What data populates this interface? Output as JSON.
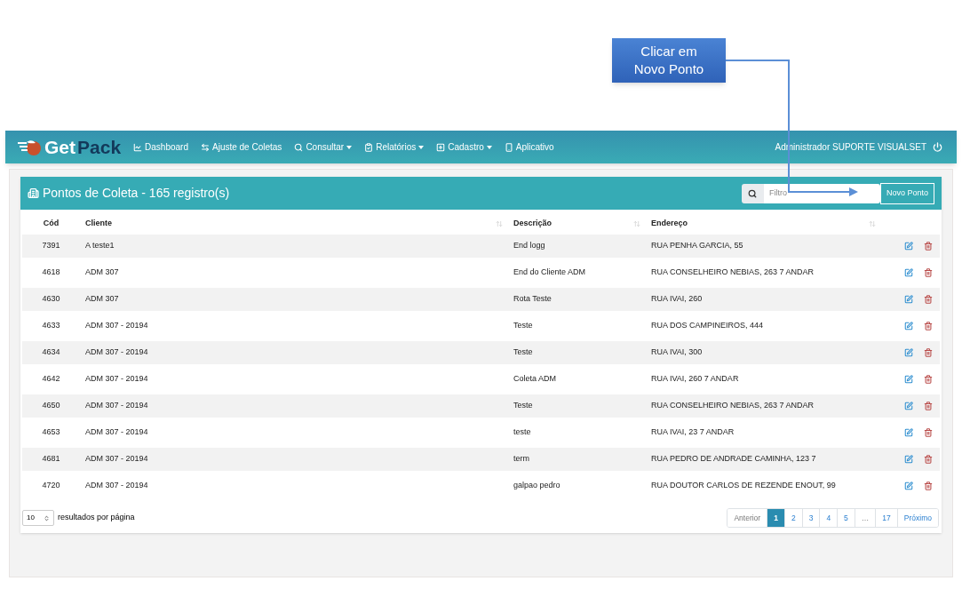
{
  "callout": {
    "lines": [
      "Clicar em",
      "Novo Ponto"
    ]
  },
  "navbar": {
    "logo": {
      "first": "Get",
      "second": "Pack"
    },
    "items": [
      {
        "label": "Dashboard",
        "kind": "chart",
        "dropdown": false
      },
      {
        "label": "Ajuste de Coletas",
        "kind": "swap",
        "dropdown": false
      },
      {
        "label": "Consultar",
        "kind": "search",
        "dropdown": true
      },
      {
        "label": "Relatórios",
        "kind": "clipboard",
        "dropdown": true
      },
      {
        "label": "Cadastro",
        "kind": "grid",
        "dropdown": true
      },
      {
        "label": "Aplicativo",
        "kind": "phone",
        "dropdown": false
      }
    ],
    "user": "Administrador SUPORTE VISUALSET"
  },
  "card": {
    "title": "Pontos de Coleta - 165 registro(s)",
    "filter": {
      "placeholder": "Filtro"
    },
    "new_button": "Novo Ponto"
  },
  "table": {
    "columns": [
      {
        "label": "Cód",
        "sortable": false
      },
      {
        "label": "Cliente",
        "sortable": true
      },
      {
        "label": "Descrição",
        "sortable": true
      },
      {
        "label": "Endereço",
        "sortable": true
      }
    ],
    "rows": [
      [
        "7391",
        "A teste1",
        "End logg",
        "RUA PENHA GARCIA, 55"
      ],
      [
        "4618",
        "ADM 307",
        "End do Cliente ADM",
        "RUA CONSELHEIRO NEBIAS, 263 7 ANDAR"
      ],
      [
        "4630",
        "ADM 307",
        "Rota Teste",
        "RUA IVAI, 260"
      ],
      [
        "4633",
        "ADM 307 - 20194",
        "Teste",
        "RUA DOS CAMPINEIROS, 444"
      ],
      [
        "4634",
        "ADM 307 - 20194",
        "Teste",
        "RUA IVAI, 300"
      ],
      [
        "4642",
        "ADM 307 - 20194",
        "Coleta ADM",
        "RUA IVAI, 260 7 ANDAR"
      ],
      [
        "4650",
        "ADM 307 - 20194",
        "Teste",
        "RUA CONSELHEIRO NEBIAS, 263 7 ANDAR"
      ],
      [
        "4653",
        "ADM 307 - 20194",
        "teste",
        "RUA IVAI, 23 7 ANDAR"
      ],
      [
        "4681",
        "ADM 307 - 20194",
        "term",
        "RUA PEDRO DE ANDRADE CAMINHA, 123 7"
      ],
      [
        "4720",
        "ADM 307 - 20194",
        "galpao pedro",
        "RUA DOUTOR CARLOS DE REZENDE ENOUT, 99"
      ]
    ]
  },
  "page_size": {
    "value": "10",
    "label": "resultados por página"
  },
  "pagination": [
    {
      "label": "Anterior",
      "selected": false,
      "disabled": true
    },
    {
      "label": "1",
      "selected": true,
      "disabled": false
    },
    {
      "label": "2",
      "selected": false,
      "disabled": false
    },
    {
      "label": "3",
      "selected": false,
      "disabled": false
    },
    {
      "label": "4",
      "selected": false,
      "disabled": false
    },
    {
      "label": "5",
      "selected": false,
      "disabled": false
    },
    {
      "label": "…",
      "selected": false,
      "disabled": true
    },
    {
      "label": "17",
      "selected": false,
      "disabled": false
    },
    {
      "label": "Próximo",
      "selected": false,
      "disabled": false
    }
  ]
}
